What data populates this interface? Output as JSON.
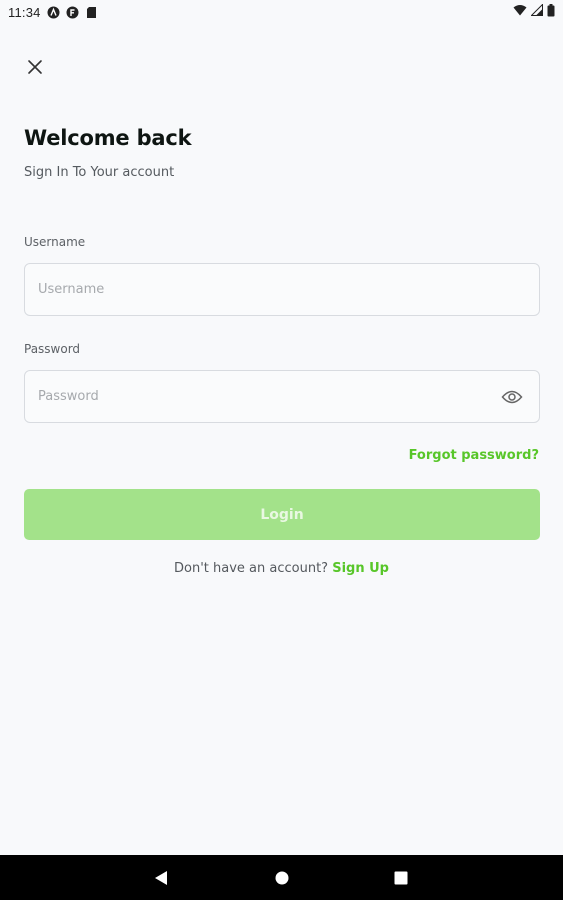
{
  "status_bar": {
    "time": "11:34",
    "left_icons": [
      "automation-icon",
      "f-circle-icon",
      "sd-card-icon"
    ],
    "right_icons": [
      "wifi-icon",
      "signal-icon",
      "battery-icon"
    ]
  },
  "header": {
    "close_icon": "close-icon",
    "title": "Welcome back",
    "subtitle": "Sign In To Your account"
  },
  "form": {
    "username_label": "Username",
    "username_placeholder": "Username",
    "username_value": "",
    "password_label": "Password",
    "password_placeholder": "Password",
    "password_value": "",
    "eye_icon": "eye-icon",
    "forgot_label": "Forgot password?",
    "login_label": "Login"
  },
  "footer": {
    "prompt": "Don't have an account?",
    "signup_label": "Sign Up"
  },
  "colors": {
    "accent": "#58c629",
    "login_button": "#a3e28a",
    "background": "#f8f9fb"
  },
  "nav_bar": {
    "icons": [
      "back-icon",
      "home-icon",
      "recents-icon"
    ]
  }
}
